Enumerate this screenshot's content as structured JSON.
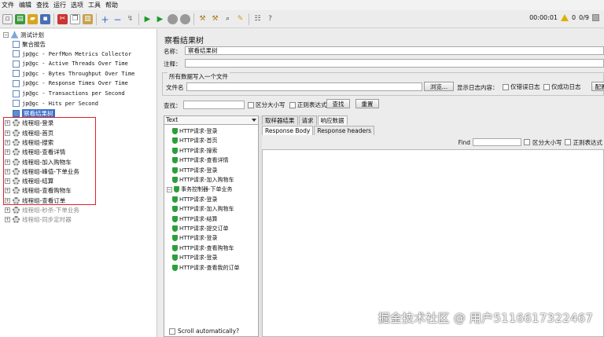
{
  "menubar": [
    "文件",
    "编辑",
    "查找",
    "运行",
    "选项",
    "工具",
    "帮助"
  ],
  "status": {
    "timer": "00:00:01",
    "threads": "0",
    "count": "0/9"
  },
  "tree": {
    "root": "测试计划",
    "items": [
      {
        "label": "聚合报告",
        "mono": false
      },
      {
        "label": "jp@gc - PerfMon Metrics Collector",
        "mono": true
      },
      {
        "label": "jp@gc - Active Threads Over Time",
        "mono": true
      },
      {
        "label": "jp@gc - Bytes Throughput Over Time",
        "mono": true
      },
      {
        "label": "jp@gc - Response Times Over Time",
        "mono": true
      },
      {
        "label": "jp@gc - Transactions per Second",
        "mono": true
      },
      {
        "label": "jp@gc - Hits per Second",
        "mono": true
      }
    ],
    "selected": "察看结果树",
    "groups": [
      "线程组-登录",
      "线程组-首页",
      "线程组-搜索",
      "线程组-查看详情",
      "线程组-加入购物车",
      "线程组-峰值-下单业务",
      "线程组-结算",
      "线程组-查看购物车",
      "线程组-查看订单"
    ],
    "disabled_groups": [
      "线程组-秒杀-下单业务",
      "线程组-同步定时器"
    ]
  },
  "panel": {
    "title": "察看结果树",
    "name_label": "名称：",
    "name_value": "察看结果树",
    "comment_label": "注释：",
    "write_all": "所有数据写入一个文件",
    "filename_label": "文件名",
    "browse": "浏览...",
    "show_log": "显示日志内容：",
    "errors_only": "仅错误日志",
    "success_only": "仅成功日志",
    "configure": "配置",
    "search_label": "查找：",
    "case_sensitive": "区分大小写",
    "regex": "正则表达式",
    "search_btn": "查找",
    "reset_btn": "重置"
  },
  "renderer": "Text",
  "samples": [
    {
      "label": "HTTP请求-登录",
      "indent": 1,
      "type": "ok"
    },
    {
      "label": "HTTP请求-首页",
      "indent": 1,
      "type": "ok"
    },
    {
      "label": "HTTP请求-搜索",
      "indent": 1,
      "type": "ok"
    },
    {
      "label": "HTTP请求-查看详情",
      "indent": 1,
      "type": "ok"
    },
    {
      "label": "HTTP请求-登录",
      "indent": 1,
      "type": "ok"
    },
    {
      "label": "HTTP请求-加入购物车",
      "indent": 1,
      "type": "ok"
    },
    {
      "label": "事务控制器-下单业务",
      "indent": 0,
      "type": "group"
    },
    {
      "label": "HTTP请求-登录",
      "indent": 1,
      "type": "ok"
    },
    {
      "label": "HTTP请求-加入购物车",
      "indent": 1,
      "type": "ok"
    },
    {
      "label": "HTTP请求-结算",
      "indent": 1,
      "type": "ok"
    },
    {
      "label": "HTTP请求-提交订单",
      "indent": 1,
      "type": "ok"
    },
    {
      "label": "HTTP请求-登录",
      "indent": 1,
      "type": "ok"
    },
    {
      "label": "HTTP请求-查看购物车",
      "indent": 1,
      "type": "ok"
    },
    {
      "label": "HTTP请求-登录",
      "indent": 1,
      "type": "ok"
    },
    {
      "label": "HTTP请求-查看我的订单",
      "indent": 1,
      "type": "ok"
    }
  ],
  "scroll_auto": "Scroll automatically?",
  "tabs": [
    "取样器结果",
    "请求",
    "响应数据"
  ],
  "subtabs": [
    "Response Body",
    "Response headers"
  ],
  "find": {
    "label": "Find",
    "case": "区分大小写",
    "regex": "正则表达式"
  },
  "watermark": "掘金技术社区 @ 用户5116617322467"
}
